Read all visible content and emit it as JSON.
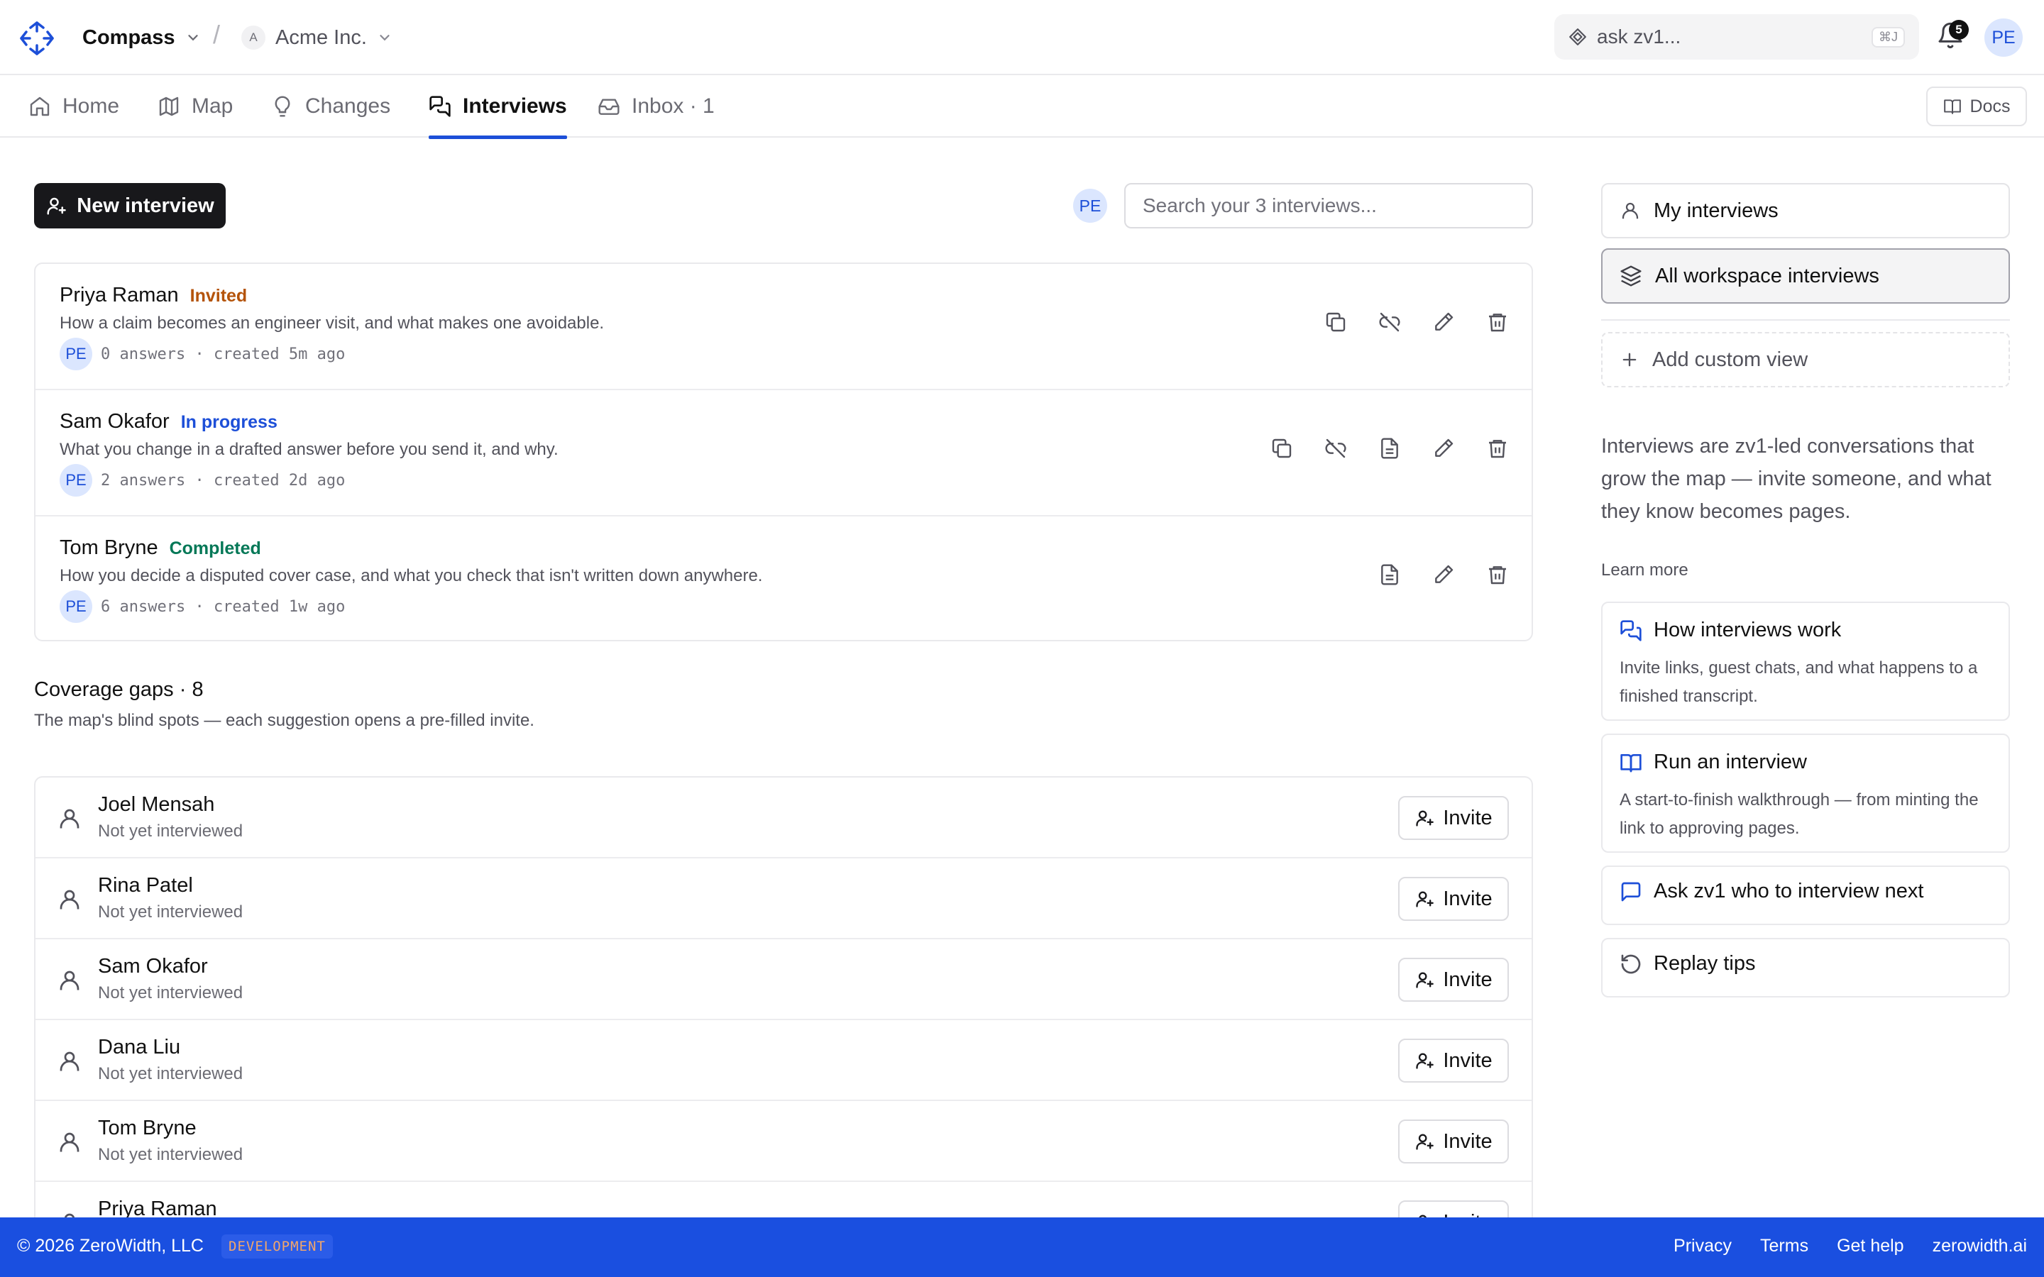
{
  "header": {
    "workspace": "Compass",
    "separator": "/",
    "org_initial": "A",
    "org_name": "Acme Inc.",
    "ask_placeholder": "ask zv1...",
    "ask_shortcut": "⌘J",
    "notification_count": "5",
    "user_initials": "PE"
  },
  "nav": {
    "tabs": [
      {
        "label": "Home",
        "icon": "home-icon"
      },
      {
        "label": "Map",
        "icon": "map-icon"
      },
      {
        "label": "Changes",
        "icon": "lightbulb-icon"
      },
      {
        "label": "Interviews",
        "icon": "chat-bubbles-icon",
        "active": true
      },
      {
        "label": "Inbox · 1",
        "icon": "inbox-icon"
      }
    ],
    "docs_label": "Docs"
  },
  "toolbar": {
    "new_interview_label": "New interview",
    "owner_initials": "PE",
    "search_placeholder": "Search your 3 interviews..."
  },
  "interviews": [
    {
      "name": "Priya Raman",
      "status": "Invited",
      "status_color": "#b45309",
      "description": "How a claim becomes an engineer visit, and what makes one avoidable.",
      "owner_initials": "PE",
      "meta": "0 answers · created 5m ago",
      "actions": [
        "copy-icon",
        "unlink-icon",
        "edit-icon",
        "trash-icon"
      ]
    },
    {
      "name": "Sam Okafor",
      "status": "In progress",
      "status_color": "#1d4fd8",
      "description": "What you change in a drafted answer before you send it, and why.",
      "owner_initials": "PE",
      "meta": "2 answers · created 2d ago",
      "actions": [
        "copy-icon",
        "unlink-icon",
        "transcript-icon",
        "edit-icon",
        "trash-icon"
      ]
    },
    {
      "name": "Tom Bryne",
      "status": "Completed",
      "status_color": "#047857",
      "description": "How you decide a disputed cover case, and what you check that isn't written down anywhere.",
      "owner_initials": "PE",
      "meta": "6 answers · created 1w ago",
      "actions": [
        "transcript-icon",
        "edit-icon",
        "trash-icon"
      ]
    }
  ],
  "coverage": {
    "title": "Coverage gaps · 8",
    "subtitle": "The map's blind spots — each suggestion opens a pre-filled invite.",
    "invite_label": "Invite",
    "rows": [
      {
        "name": "Joel Mensah",
        "status": "Not yet interviewed"
      },
      {
        "name": "Rina Patel",
        "status": "Not yet interviewed"
      },
      {
        "name": "Sam Okafor",
        "status": "Not yet interviewed"
      },
      {
        "name": "Dana Liu",
        "status": "Not yet interviewed"
      },
      {
        "name": "Tom Bryne",
        "status": "Not yet interviewed"
      },
      {
        "name": "Priya Raman",
        "status": ""
      }
    ]
  },
  "sidebar": {
    "views": [
      {
        "label": "My interviews",
        "icon": "user-icon"
      },
      {
        "label": "All workspace interviews",
        "icon": "layers-icon",
        "selected": true
      }
    ],
    "add_view_label": "Add custom view",
    "about": "Interviews are zv1-led conversations that grow the map — invite someone, and what they know becomes pages.",
    "learn_more_heading": "Learn more",
    "links": [
      {
        "title": "How interviews work",
        "description": "Invite links, guest chats, and what happens to a finished transcript.",
        "icon": "chat-bubbles-icon"
      },
      {
        "title": "Run an interview",
        "description": "A start-to-finish walkthrough — from minting the link to approving pages.",
        "icon": "book-icon"
      },
      {
        "title": "Ask zv1 who to interview next",
        "description": "",
        "icon": "message-icon"
      },
      {
        "title": "Replay tips",
        "description": "",
        "icon": "replay-icon"
      }
    ]
  },
  "footer": {
    "copyright": "© 2026 ZeroWidth, LLC",
    "env_badge": "DEVELOPMENT",
    "links": [
      "Privacy",
      "Terms",
      "Get help",
      "zerowidth.ai"
    ]
  },
  "colors": {
    "accent": "#1d4fd8",
    "footer_bg": "#1a4fe0",
    "primary_button": "#18181b"
  }
}
